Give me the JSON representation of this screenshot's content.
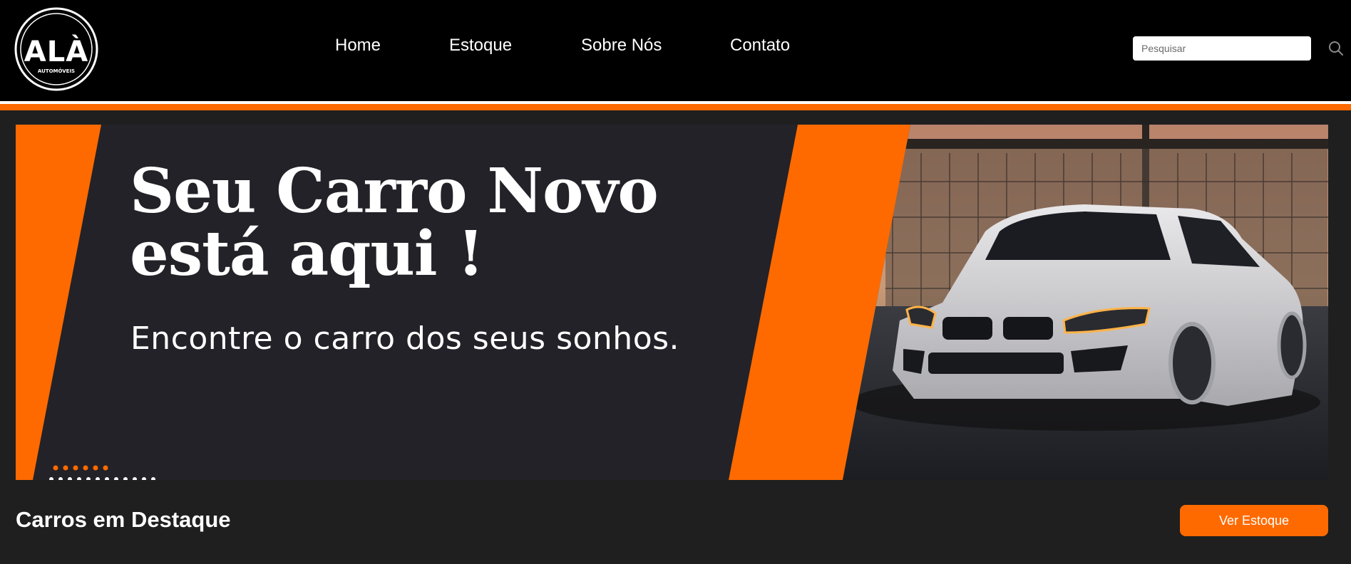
{
  "brand": {
    "logo_letters": "ALÀ",
    "logo_tagline": "AUTOMÓVEIS"
  },
  "nav": {
    "items": [
      {
        "label": "Home"
      },
      {
        "label": "Estoque"
      },
      {
        "label": "Sobre Nós"
      },
      {
        "label": "Contato"
      }
    ]
  },
  "search": {
    "placeholder": "Pesquisar",
    "value": ""
  },
  "banner": {
    "headline_line1": "Seu Carro Novo",
    "headline_line2": "está aqui !",
    "subheadline": "Encontre o carro dos seus sonhos.",
    "image": "white-bmw-sedan-photo"
  },
  "featured": {
    "title": "Carros em Destaque",
    "button_label": "Ver Estoque"
  },
  "colors": {
    "accent": "#ff6a00",
    "header_bg": "#000000",
    "page_bg": "#1f1f1f",
    "banner_bg": "#232228",
    "text": "#ffffff"
  }
}
